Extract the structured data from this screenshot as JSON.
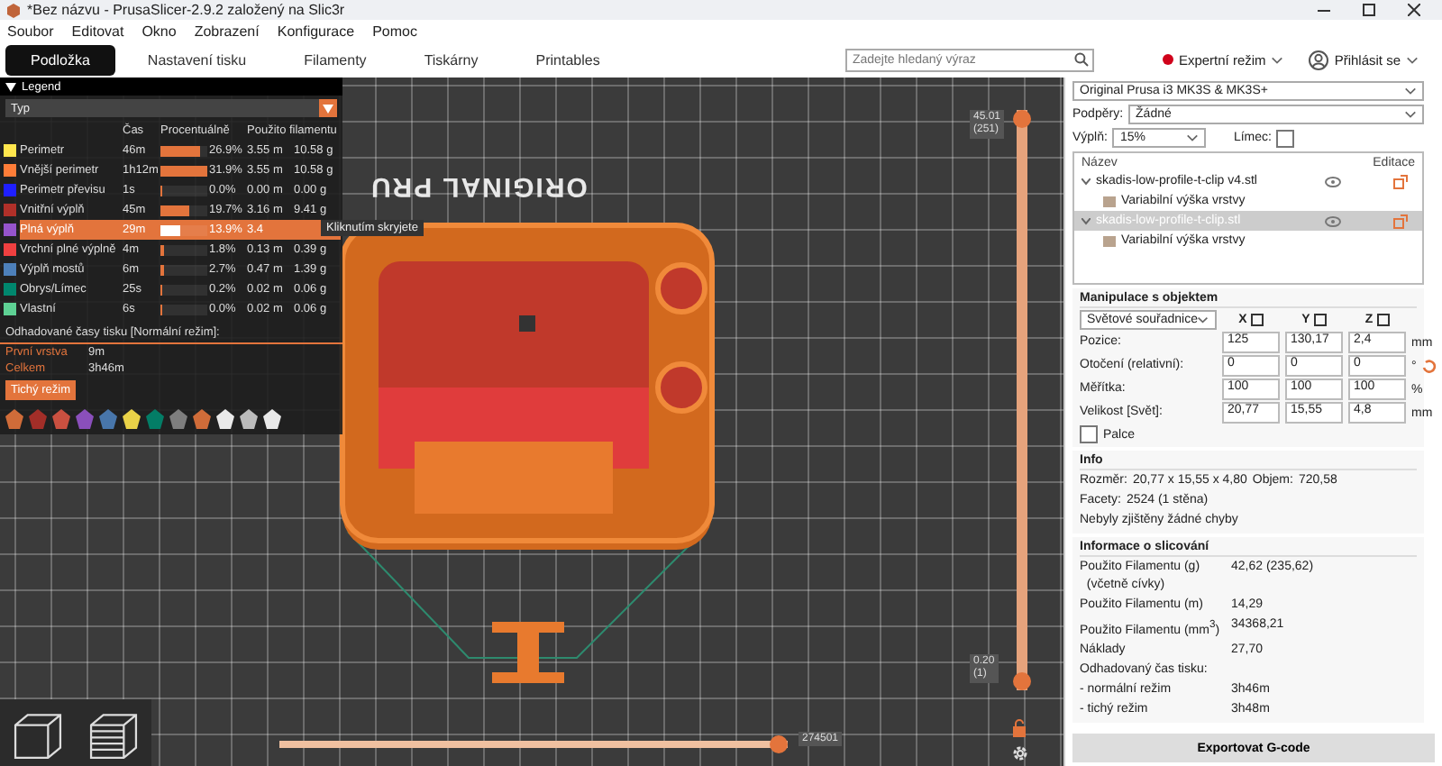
{
  "window": {
    "title": "*Bez názvu - PrusaSlicer-2.9.2 založený na Slic3r"
  },
  "menu": [
    "Soubor",
    "Editovat",
    "Okno",
    "Zobrazení",
    "Konfigurace",
    "Pomoc"
  ],
  "tabs": [
    {
      "label": "Podložka",
      "selected": true
    },
    {
      "label": "Nastavení tisku",
      "selected": false
    },
    {
      "label": "Filamenty",
      "selected": false
    },
    {
      "label": "Tiskárny",
      "selected": false
    },
    {
      "label": "Printables",
      "selected": false
    }
  ],
  "search": {
    "placeholder": "Zadejte hledaný výraz"
  },
  "mode": {
    "label": "Expertní režim"
  },
  "account": {
    "label": "Přihlásit se"
  },
  "viewport": {
    "bed_label": "ORIGINAL PRU",
    "vertical_slider": {
      "top": {
        "label": "45.01",
        "layer": "(251)",
        "level": 1
      },
      "bottom": {
        "label": "0.20",
        "layer": "(1)",
        "level": 0
      }
    },
    "horizontal_slider": {
      "label": "274501",
      "level": 1
    }
  },
  "legend": {
    "title": "Legend",
    "view_type": "Typ",
    "columns": [
      "Čas",
      "Procentuálně",
      "Použito filamentu"
    ],
    "rows": [
      {
        "name": "Perimetr",
        "time": "46m",
        "percent": "26.9%",
        "level": 0.84,
        "length": "3.55 m",
        "weight": "10.58 g",
        "color": "#ffe64d",
        "selected": false
      },
      {
        "name": "Vnější perimetr",
        "time": "1h12m",
        "percent": "31.9%",
        "level": 1,
        "length": "3.55 m",
        "weight": "10.58 g",
        "color": "#ff7d38",
        "selected": false
      },
      {
        "name": "Perimetr převisu",
        "time": "1s",
        "percent": "0.0%",
        "level": 0,
        "length": "0.00 m",
        "weight": "0.00 g",
        "color": "#1f1fff",
        "selected": false
      },
      {
        "name": "Vnitřní výplň",
        "time": "45m",
        "percent": "19.7%",
        "level": 0.62,
        "length": "3.16 m",
        "weight": "9.41 g",
        "color": "#b03029",
        "selected": false
      },
      {
        "name": "Plná výplň",
        "time": "29m",
        "percent": "13.9%",
        "level": 0.44,
        "length": "3.4",
        "color": "#9654cc",
        "selected": true
      },
      {
        "name": "Vrchní plné výplně",
        "time": "4m",
        "percent": "1.8%",
        "level": 0.06,
        "length": "0.13 m",
        "weight": "0.39 g",
        "color": "#f04040",
        "selected": false
      },
      {
        "name": "Výplň mostů",
        "time": "6m",
        "percent": "2.7%",
        "level": 0.08,
        "length": "0.47 m",
        "weight": "1.39 g",
        "color": "#4d80ba",
        "selected": false
      },
      {
        "name": "Obrys/Límec",
        "time": "25s",
        "percent": "0.2%",
        "level": 0.01,
        "length": "0.02 m",
        "weight": "0.06 g",
        "color": "#00876e",
        "selected": false
      },
      {
        "name": "Vlastní",
        "time": "6s",
        "percent": "0.0%",
        "level": 0,
        "length": "0.02 m",
        "weight": "0.06 g",
        "color": "#5ed194",
        "selected": false
      }
    ],
    "tooltip": "Kliknutím skryjete",
    "estimate_title": "Odhadované časy tisku [Normální režim]:",
    "estimates": [
      {
        "label": "První vrstva",
        "value": "9m"
      },
      {
        "label": "Celkem",
        "value": "3h46m"
      }
    ],
    "mode_button": "Tichý režim"
  },
  "printer": "Original Prusa i3 MK3S & MK3S+",
  "supports": {
    "label": "Podpěry:",
    "value": "Žádné"
  },
  "infill": {
    "label": "Výplň:",
    "value": "15%"
  },
  "brim": {
    "label": "Límec:",
    "checked": false
  },
  "objects": {
    "columns": [
      "Název",
      "Editace"
    ],
    "items": [
      {
        "name": "skadis-low-profile-t-clip v4.stl",
        "selected": false,
        "children": [
          {
            "name": "Variabilní výška vrstvy"
          }
        ]
      },
      {
        "name": "skadis-low-profile-t-clip.stl",
        "selected": true,
        "children": [
          {
            "name": "Variabilní výška vrstvy"
          }
        ]
      }
    ]
  },
  "manipulation": {
    "title": "Manipulace s objektem",
    "coordinates": "Světové souřadnice",
    "axes": [
      "X",
      "Y",
      "Z"
    ],
    "rows": [
      {
        "label": "Pozice:",
        "values": [
          "125",
          "130,17",
          "2,4"
        ],
        "unit": "mm"
      },
      {
        "label": "Otočení (relativní):",
        "values": [
          "0",
          "0",
          "0"
        ],
        "unit": "°"
      },
      {
        "label": "Měřítka:",
        "values": [
          "100",
          "100",
          "100"
        ],
        "unit": "%"
      },
      {
        "label": "Velikost [Svět]:",
        "values": [
          "20,77",
          "15,55",
          "4,8"
        ],
        "unit": "mm"
      }
    ],
    "inches": {
      "label": "Palce",
      "checked": false
    }
  },
  "info": {
    "title": "Info",
    "size_label": "Rozměr:",
    "size": "20,77 x 15,55 x 4,80",
    "volume_label": "Objem:",
    "volume": "720,58",
    "facets_label": "Facety:",
    "facets": "2524 (1 stěna)",
    "status": "Nebyly zjištěny žádné chyby"
  },
  "slicing": {
    "title": "Informace o slicování",
    "rows": [
      {
        "label": "Použito Filamentu (g)",
        "sub": "(včetně cívky)",
        "value": "42,62 (235,62)"
      },
      {
        "label": "Použito Filamentu (m)",
        "value": "14,29"
      },
      {
        "label": "Použito Filamentu (mm$^{3}$)",
        "value": "34368,21"
      },
      {
        "label": "Náklady",
        "value": "27,70"
      }
    ],
    "time_title": "Odhadovaný čas tisku:",
    "times": [
      {
        "label": "- normální režim",
        "value": "3h46m"
      },
      {
        "label": "- tichý režim",
        "value": "3h48m"
      }
    ]
  },
  "export_button": "Exportovat G-code"
}
